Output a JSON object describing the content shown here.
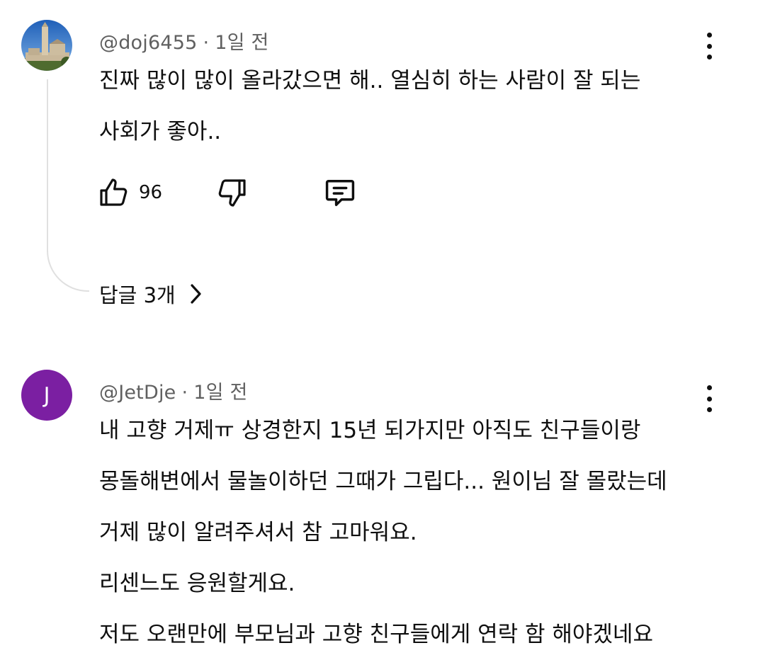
{
  "comments": [
    {
      "author": "@doj6455",
      "separator": "·",
      "time": "1일 전",
      "text_lines": [
        "진짜 많이 많이 올라갔으면 해.. 열심히 하는 사람이 잘 되는",
        "사회가 좋아.."
      ],
      "like_count": "96",
      "replies_label": "답글 3개"
    },
    {
      "author": "@JetDje",
      "separator": "·",
      "time": "1일 전",
      "avatar_letter": "J",
      "avatar_color": "#7b1fa2",
      "text_lines": [
        "내 고향 거제ㅠ 상경한지 15년 되가지만 아직도 친구들이랑",
        "몽돌해변에서 물놀이하던 그때가 그립다... 원이님 잘 몰랐는데",
        "거제 많이 알려주셔서 참 고마워요.",
        "리센느도 응원할게요.",
        "저도 오랜만에 부모님과 고향 친구들에게 연락 함 해야겠네요"
      ]
    }
  ],
  "icons": {
    "like": "thumbs-up-icon",
    "dislike": "thumbs-down-icon",
    "reply": "comment-icon",
    "more": "more-vertical-icon",
    "chevron": "chevron-right-icon"
  }
}
